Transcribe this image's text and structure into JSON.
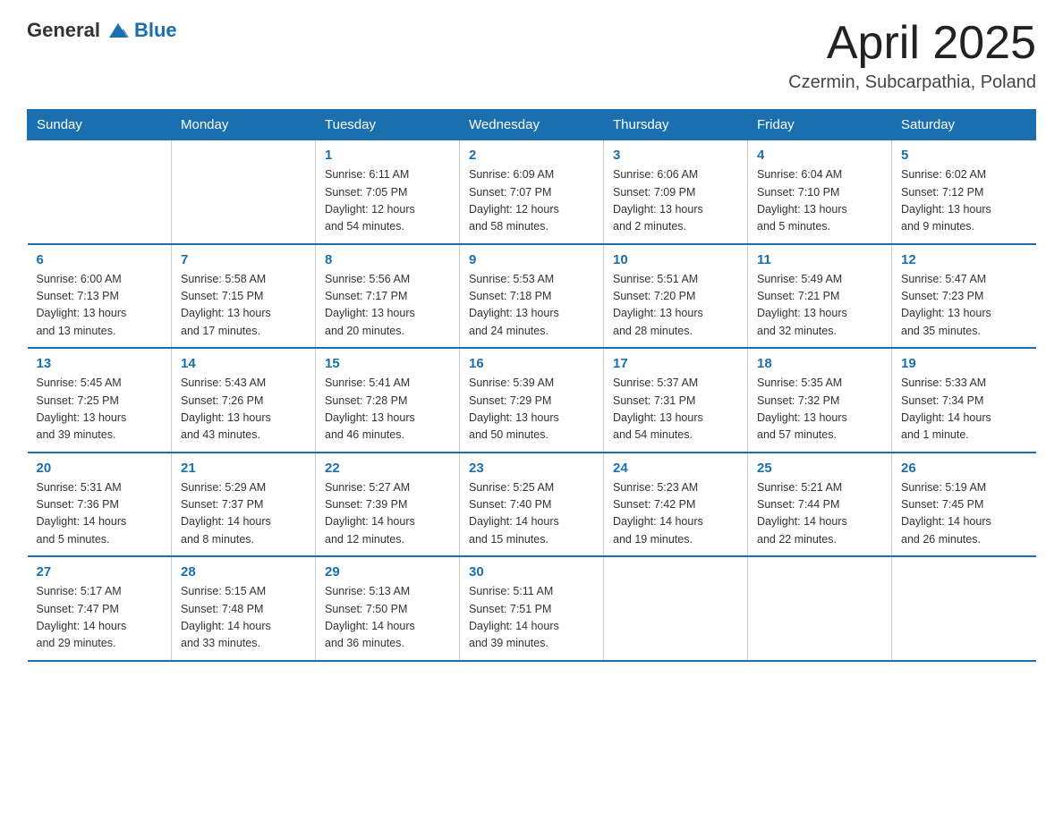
{
  "header": {
    "logo": {
      "general": "General",
      "blue": "Blue"
    },
    "title": "April 2025",
    "subtitle": "Czermin, Subcarpathia, Poland"
  },
  "days_of_week": [
    "Sunday",
    "Monday",
    "Tuesday",
    "Wednesday",
    "Thursday",
    "Friday",
    "Saturday"
  ],
  "weeks": [
    [
      {
        "day": "",
        "info": ""
      },
      {
        "day": "",
        "info": ""
      },
      {
        "day": "1",
        "info": "Sunrise: 6:11 AM\nSunset: 7:05 PM\nDaylight: 12 hours\nand 54 minutes."
      },
      {
        "day": "2",
        "info": "Sunrise: 6:09 AM\nSunset: 7:07 PM\nDaylight: 12 hours\nand 58 minutes."
      },
      {
        "day": "3",
        "info": "Sunrise: 6:06 AM\nSunset: 7:09 PM\nDaylight: 13 hours\nand 2 minutes."
      },
      {
        "day": "4",
        "info": "Sunrise: 6:04 AM\nSunset: 7:10 PM\nDaylight: 13 hours\nand 5 minutes."
      },
      {
        "day": "5",
        "info": "Sunrise: 6:02 AM\nSunset: 7:12 PM\nDaylight: 13 hours\nand 9 minutes."
      }
    ],
    [
      {
        "day": "6",
        "info": "Sunrise: 6:00 AM\nSunset: 7:13 PM\nDaylight: 13 hours\nand 13 minutes."
      },
      {
        "day": "7",
        "info": "Sunrise: 5:58 AM\nSunset: 7:15 PM\nDaylight: 13 hours\nand 17 minutes."
      },
      {
        "day": "8",
        "info": "Sunrise: 5:56 AM\nSunset: 7:17 PM\nDaylight: 13 hours\nand 20 minutes."
      },
      {
        "day": "9",
        "info": "Sunrise: 5:53 AM\nSunset: 7:18 PM\nDaylight: 13 hours\nand 24 minutes."
      },
      {
        "day": "10",
        "info": "Sunrise: 5:51 AM\nSunset: 7:20 PM\nDaylight: 13 hours\nand 28 minutes."
      },
      {
        "day": "11",
        "info": "Sunrise: 5:49 AM\nSunset: 7:21 PM\nDaylight: 13 hours\nand 32 minutes."
      },
      {
        "day": "12",
        "info": "Sunrise: 5:47 AM\nSunset: 7:23 PM\nDaylight: 13 hours\nand 35 minutes."
      }
    ],
    [
      {
        "day": "13",
        "info": "Sunrise: 5:45 AM\nSunset: 7:25 PM\nDaylight: 13 hours\nand 39 minutes."
      },
      {
        "day": "14",
        "info": "Sunrise: 5:43 AM\nSunset: 7:26 PM\nDaylight: 13 hours\nand 43 minutes."
      },
      {
        "day": "15",
        "info": "Sunrise: 5:41 AM\nSunset: 7:28 PM\nDaylight: 13 hours\nand 46 minutes."
      },
      {
        "day": "16",
        "info": "Sunrise: 5:39 AM\nSunset: 7:29 PM\nDaylight: 13 hours\nand 50 minutes."
      },
      {
        "day": "17",
        "info": "Sunrise: 5:37 AM\nSunset: 7:31 PM\nDaylight: 13 hours\nand 54 minutes."
      },
      {
        "day": "18",
        "info": "Sunrise: 5:35 AM\nSunset: 7:32 PM\nDaylight: 13 hours\nand 57 minutes."
      },
      {
        "day": "19",
        "info": "Sunrise: 5:33 AM\nSunset: 7:34 PM\nDaylight: 14 hours\nand 1 minute."
      }
    ],
    [
      {
        "day": "20",
        "info": "Sunrise: 5:31 AM\nSunset: 7:36 PM\nDaylight: 14 hours\nand 5 minutes."
      },
      {
        "day": "21",
        "info": "Sunrise: 5:29 AM\nSunset: 7:37 PM\nDaylight: 14 hours\nand 8 minutes."
      },
      {
        "day": "22",
        "info": "Sunrise: 5:27 AM\nSunset: 7:39 PM\nDaylight: 14 hours\nand 12 minutes."
      },
      {
        "day": "23",
        "info": "Sunrise: 5:25 AM\nSunset: 7:40 PM\nDaylight: 14 hours\nand 15 minutes."
      },
      {
        "day": "24",
        "info": "Sunrise: 5:23 AM\nSunset: 7:42 PM\nDaylight: 14 hours\nand 19 minutes."
      },
      {
        "day": "25",
        "info": "Sunrise: 5:21 AM\nSunset: 7:44 PM\nDaylight: 14 hours\nand 22 minutes."
      },
      {
        "day": "26",
        "info": "Sunrise: 5:19 AM\nSunset: 7:45 PM\nDaylight: 14 hours\nand 26 minutes."
      }
    ],
    [
      {
        "day": "27",
        "info": "Sunrise: 5:17 AM\nSunset: 7:47 PM\nDaylight: 14 hours\nand 29 minutes."
      },
      {
        "day": "28",
        "info": "Sunrise: 5:15 AM\nSunset: 7:48 PM\nDaylight: 14 hours\nand 33 minutes."
      },
      {
        "day": "29",
        "info": "Sunrise: 5:13 AM\nSunset: 7:50 PM\nDaylight: 14 hours\nand 36 minutes."
      },
      {
        "day": "30",
        "info": "Sunrise: 5:11 AM\nSunset: 7:51 PM\nDaylight: 14 hours\nand 39 minutes."
      },
      {
        "day": "",
        "info": ""
      },
      {
        "day": "",
        "info": ""
      },
      {
        "day": "",
        "info": ""
      }
    ]
  ]
}
